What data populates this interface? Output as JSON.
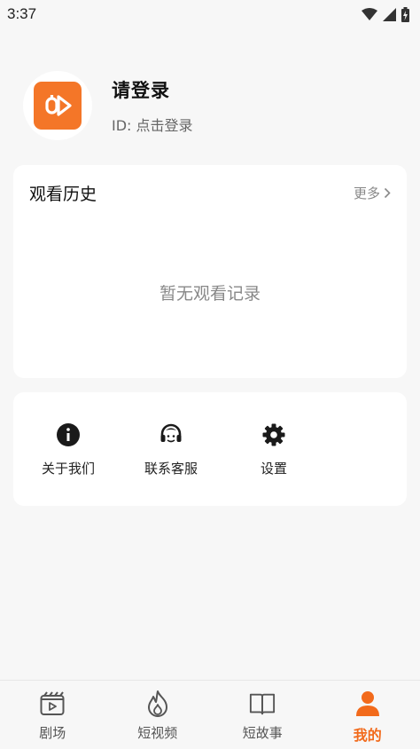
{
  "status_bar": {
    "time": "3:37"
  },
  "profile": {
    "title": "请登录",
    "id_text": "ID: 点击登录"
  },
  "history": {
    "title": "观看历史",
    "more": "更多",
    "empty": "暂无观看记录"
  },
  "menu": {
    "items": [
      {
        "label": "关于我们",
        "icon": "info-icon"
      },
      {
        "label": "联系客服",
        "icon": "headset-icon"
      },
      {
        "label": "设置",
        "icon": "gear-icon"
      }
    ]
  },
  "tabs": [
    {
      "label": "剧场",
      "icon": "theater-icon",
      "active": false
    },
    {
      "label": "短视频",
      "icon": "flame-icon",
      "active": false
    },
    {
      "label": "短故事",
      "icon": "book-icon",
      "active": false
    },
    {
      "label": "我的",
      "icon": "person-icon",
      "active": true
    }
  ],
  "colors": {
    "accent": "#f26a1b",
    "logo_bg": "#f47628",
    "background": "#f7f7f7"
  }
}
